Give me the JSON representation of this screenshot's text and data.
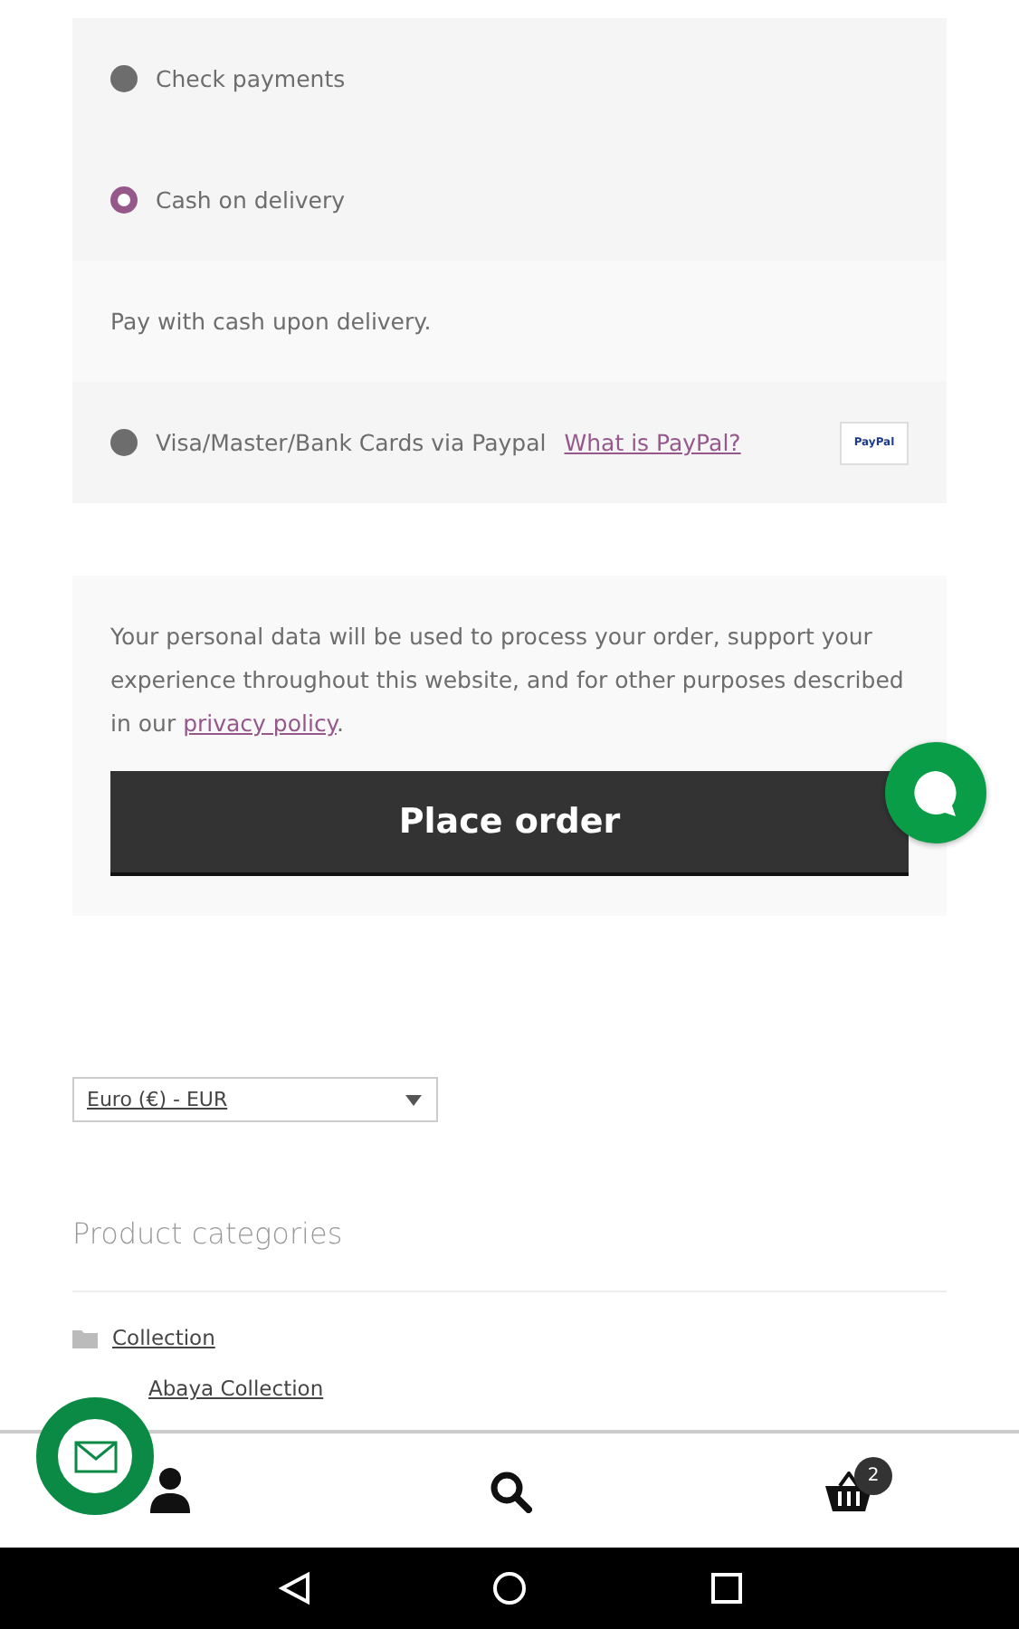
{
  "payment_methods": [
    {
      "label": "Check payments",
      "selected": false
    },
    {
      "label": "Cash on delivery",
      "selected": true,
      "description": "Pay with cash upon delivery."
    },
    {
      "label": "Visa/Master/Bank Cards via Paypal",
      "selected": false,
      "link": "What is PayPal?",
      "badge": "PayPal"
    }
  ],
  "privacy": {
    "text": "Your personal data will be used to process your order, support your experience throughout this website, and for other purposes described in our ",
    "link": "privacy policy",
    "after": "."
  },
  "place_order": "Place order",
  "currency": {
    "value": "Euro (€) - EUR"
  },
  "categories": {
    "title": "Product categories",
    "items": [
      {
        "label": "Collection",
        "children": [
          {
            "label": "Abaya Collection"
          }
        ]
      }
    ]
  },
  "bottom_bar": {
    "cart_count": "2"
  }
}
